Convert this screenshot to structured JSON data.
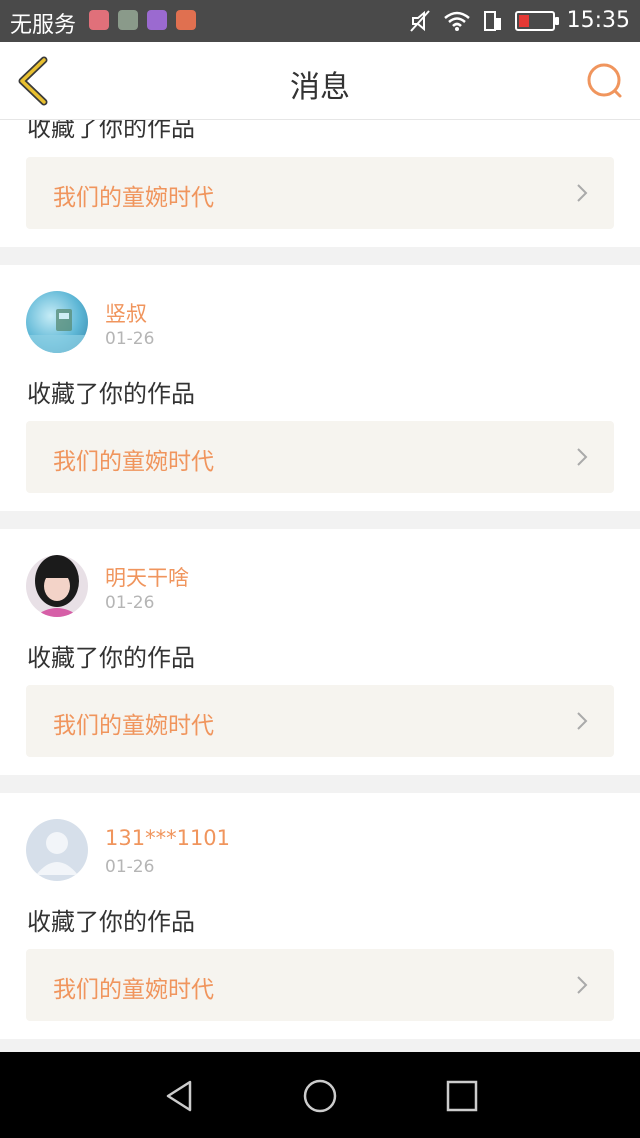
{
  "status_bar": {
    "carrier": "无服务",
    "time": "15:35",
    "app_icon_colors": [
      "#e0707a",
      "#8a9a8a",
      "#9b6ad0",
      "#e07050"
    ],
    "icons": [
      "mute-icon",
      "wifi-icon",
      "signal-icon",
      "battery-low-icon"
    ]
  },
  "header": {
    "title": "消息",
    "back_icon": "back-arrow-icon",
    "search_icon": "search-icon",
    "colors": {
      "back": "#e8c030",
      "search": "#f0955d"
    }
  },
  "colors": {
    "accent": "#f0955d",
    "work_bg": "#f6f4ef",
    "text": "#333333",
    "muted": "#b5b5b5"
  },
  "top_partial": {
    "action": "收藏了你的作品",
    "work_title": "我们的童婉时代"
  },
  "notifications": [
    {
      "username": "竖叔",
      "date": "01-26",
      "action": "收藏了你的作品",
      "work_title": "我们的童婉时代",
      "avatar": "avatar-train"
    },
    {
      "username": "明天干啥",
      "date": "01-26",
      "action": "收藏了你的作品",
      "work_title": "我们的童婉时代",
      "avatar": "avatar-girl"
    },
    {
      "username": "131***1101",
      "date": "01-26",
      "action": "收藏了你的作品",
      "work_title": "我们的童婉时代",
      "avatar": "avatar-default"
    }
  ],
  "nav_bar": {
    "icons": [
      "back-triangle-icon",
      "home-circle-icon",
      "recents-square-icon"
    ]
  }
}
